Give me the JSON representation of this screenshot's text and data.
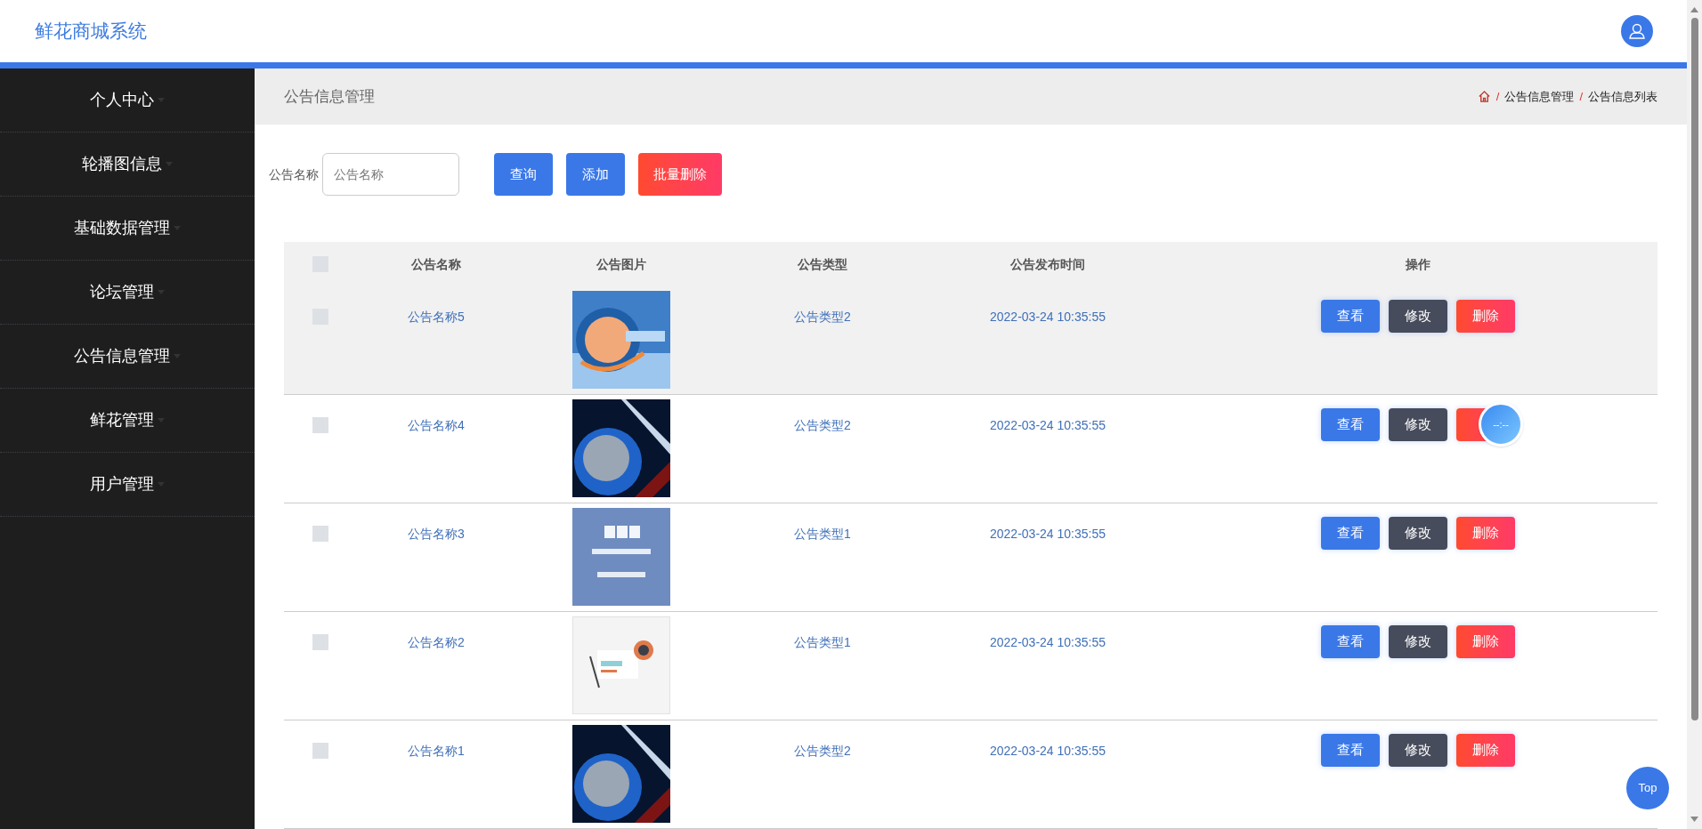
{
  "header": {
    "title": "鲜花商城系统"
  },
  "sidebar": {
    "items": [
      {
        "label": "个人中心"
      },
      {
        "label": "轮播图信息"
      },
      {
        "label": "基础数据管理"
      },
      {
        "label": "论坛管理"
      },
      {
        "label": "公告信息管理"
      },
      {
        "label": "鲜花管理"
      },
      {
        "label": "用户管理"
      }
    ]
  },
  "page_title": "公告信息管理",
  "breadcrumb": {
    "separator": "/",
    "items": [
      "公告信息管理",
      "公告信息列表"
    ]
  },
  "search": {
    "label": "公告名称",
    "placeholder": "公告名称",
    "buttons": [
      {
        "label": "查询",
        "kind": "primary"
      },
      {
        "label": "添加",
        "kind": "primary"
      },
      {
        "label": "批量删除",
        "kind": "danger"
      }
    ]
  },
  "table": {
    "select_all": {
      "checked": false
    },
    "columns": [
      "公告名称",
      "公告图片",
      "公告类型",
      "公告发布时间",
      "操作"
    ],
    "rows": [
      {
        "checked": false,
        "highlighted": true,
        "name": "公告名称5",
        "type": "公告类型2",
        "time": "2022-03-24 10:35:55",
        "actions": [
          {
            "label": "查看",
            "kind": "view"
          },
          {
            "label": "修改",
            "kind": "edit"
          },
          {
            "label": "删除",
            "kind": "delete"
          }
        ]
      },
      {
        "checked": false,
        "highlighted": false,
        "name": "公告名称4",
        "type": "公告类型2",
        "time": "2022-03-24 10:35:55",
        "actions": [
          {
            "label": "查看",
            "kind": "view"
          },
          {
            "label": "修改",
            "kind": "edit"
          },
          {
            "kind": "delete"
          }
        ]
      },
      {
        "checked": false,
        "highlighted": false,
        "name": "公告名称3",
        "type": "公告类型1",
        "time": "2022-03-24 10:35:55",
        "actions": [
          {
            "label": "查看",
            "kind": "view"
          },
          {
            "label": "修改",
            "kind": "edit"
          },
          {
            "label": "删除",
            "kind": "delete"
          }
        ]
      },
      {
        "checked": false,
        "highlighted": false,
        "name": "公告名称2",
        "type": "公告类型1",
        "time": "2022-03-24 10:35:55",
        "actions": [
          {
            "label": "查看",
            "kind": "view"
          },
          {
            "label": "修改",
            "kind": "edit"
          },
          {
            "label": "删除",
            "kind": "delete"
          }
        ]
      },
      {
        "checked": false,
        "highlighted": false,
        "name": "公告名称1",
        "type": "公告类型2",
        "time": "2022-03-24 10:35:55",
        "actions": [
          {
            "label": "查看",
            "kind": "view"
          },
          {
            "label": "修改",
            "kind": "edit"
          },
          {
            "label": "删除",
            "kind": "delete"
          }
        ]
      }
    ]
  },
  "clock_widget": {
    "text": "--:--"
  },
  "top_button": {
    "label": "Top"
  }
}
